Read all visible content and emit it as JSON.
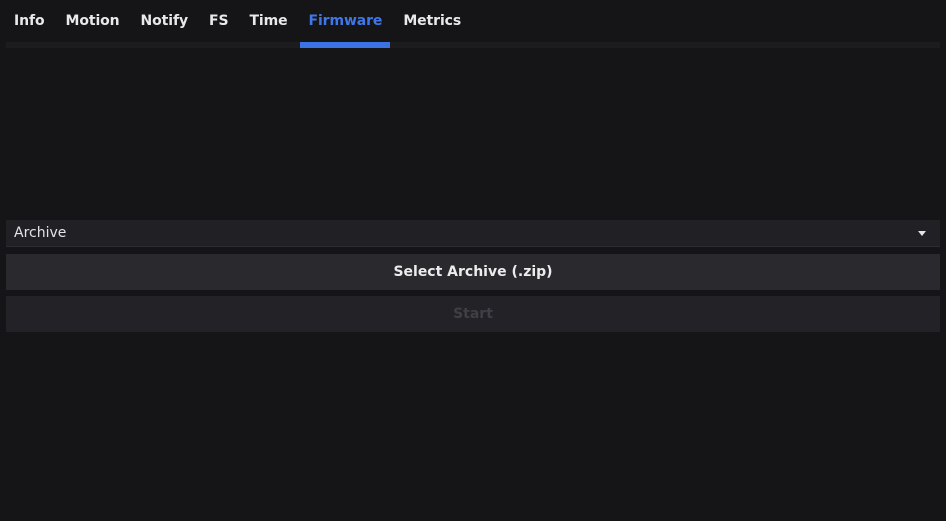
{
  "tabs": [
    {
      "label": "Info",
      "active": false
    },
    {
      "label": "Motion",
      "active": false
    },
    {
      "label": "Notify",
      "active": false
    },
    {
      "label": "FS",
      "active": false
    },
    {
      "label": "Time",
      "active": false
    },
    {
      "label": "Firmware",
      "active": true
    },
    {
      "label": "Metrics",
      "active": false
    }
  ],
  "firmware": {
    "type_select": {
      "value": "Archive"
    },
    "select_button_label": "Select Archive (.zip)",
    "start_button_label": "Start",
    "start_disabled": true
  },
  "colors": {
    "background": "#151517",
    "accent": "#3b73e4",
    "button": "#29292e",
    "button_disabled": "#232327"
  },
  "icons": {
    "select_caret": "caret-down-icon"
  }
}
